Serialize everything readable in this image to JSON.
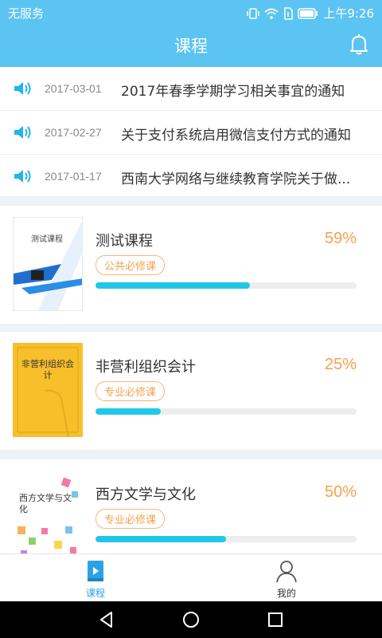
{
  "status_bar": {
    "carrier": "无服务",
    "time": "上午9:26"
  },
  "header": {
    "title": "课程"
  },
  "notices": [
    {
      "date": "2017-03-01",
      "text": "2017年春季学期学习相关事宜的通知"
    },
    {
      "date": "2017-02-27",
      "text": "关于支付系统启用微信支付方式的通知"
    },
    {
      "date": "2017-01-17",
      "text": "西南大学网络与继续教育学院关于做..."
    }
  ],
  "courses": [
    {
      "name": "测试课程",
      "percent_label": "59%",
      "progress": 0.59,
      "tag": "公共必修课",
      "cover_text": "测试课程"
    },
    {
      "name": "非营利组织会计",
      "percent_label": "25%",
      "progress": 0.25,
      "tag": "专业必修课",
      "cover_text": "非营利组织会计"
    },
    {
      "name": "西方文学与文化",
      "percent_label": "50%",
      "progress": 0.5,
      "tag": "专业必修课",
      "cover_text": "西方文学与文化"
    }
  ],
  "bottom_nav": {
    "courses_label": "课程",
    "mine_label": "我的"
  },
  "colors": {
    "header": "#5bc4f2",
    "accent": "#21c7e8",
    "percent": "#f3a24d",
    "tab_active": "#2aa3e6"
  }
}
